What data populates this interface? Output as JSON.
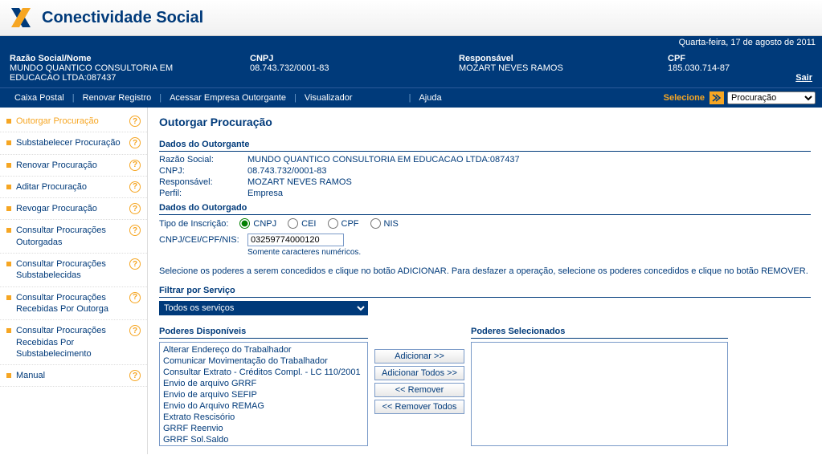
{
  "app_title": "Conectividade Social",
  "date_text": "Quarta-feira, 17 de agosto de 2011",
  "info": {
    "razao_label": "Razão Social/Nome",
    "razao_value": "MUNDO QUANTICO CONSULTORIA EM EDUCACAO LTDA:087437",
    "cnpj_label": "CNPJ",
    "cnpj_value": "08.743.732/0001-83",
    "resp_label": "Responsável",
    "resp_value": "MOZART NEVES RAMOS",
    "cpf_label": "CPF",
    "cpf_value": "185.030.714-87",
    "sair": "Sair"
  },
  "nav": {
    "caixa_postal": "Caixa Postal",
    "renovar_registro": "Renovar Registro",
    "acessar_empresa": "Acessar Empresa Outorgante",
    "visualizador": "Visualizador",
    "ajuda": "Ajuda",
    "selecione": "Selecione",
    "select_value": "Procuração"
  },
  "sidebar": {
    "items": [
      "Outorgar Procuração",
      "Substabelecer Procuração",
      "Renovar Procuração",
      "Aditar Procuração",
      "Revogar Procuração",
      "Consultar Procurações Outorgadas",
      "Consultar Procurações Substabelecidas",
      "Consultar Procurações Recebidas Por Outorga",
      "Consultar Procurações Recebidas Por Substabelecimento",
      "Manual"
    ]
  },
  "page": {
    "title": "Outorgar Procuração",
    "dados_outorgante": "Dados do Outorgante",
    "razao_lbl": "Razão Social:",
    "razao_val": "MUNDO QUANTICO CONSULTORIA EM EDUCACAO LTDA:087437",
    "cnpj_lbl": "CNPJ:",
    "cnpj_val": "08.743.732/0001-83",
    "resp_lbl": "Responsável:",
    "resp_val": "MOZART NEVES RAMOS",
    "perfil_lbl": "Perfil:",
    "perfil_val": "Empresa",
    "dados_outorgado": "Dados do Outorgado",
    "tipo_lbl": "Tipo de Inscrição:",
    "r_cnpj": "CNPJ",
    "r_cei": "CEI",
    "r_cpf": "CPF",
    "r_nis": "NIS",
    "input_lbl": "CNPJ/CEI/CPF/NIS:",
    "input_val": "03259774000120",
    "hint": "Somente caracteres numéricos.",
    "instr": "Selecione os poderes a serem concedidos e clique no botão ADICIONAR. Para desfazer a operação, selecione os poderes concedidos e clique no botão REMOVER.",
    "filtrar_lbl": "Filtrar por Serviço",
    "filtrar_val": "Todos os serviços",
    "pod_disp": "Poderes Disponíveis",
    "pod_sel": "Poderes Selecionados",
    "options": [
      "Alterar Endereço do Trabalhador",
      "Comunicar Movimentação do Trabalhador",
      "Consultar Extrato - Créditos Compl. - LC 110/2001",
      "Envio de arquivo GRRF",
      "Envio de arquivo SEFIP",
      "Envio do Arquivo REMAG",
      "Extrato Rescisório",
      "GRRF Reenvio",
      "GRRF Sol.Saldo"
    ],
    "btn_add": "Adicionar >>",
    "btn_add_all": "Adicionar Todos >>",
    "btn_rem": "<< Remover",
    "btn_rem_all": "<< Remover Todos"
  }
}
